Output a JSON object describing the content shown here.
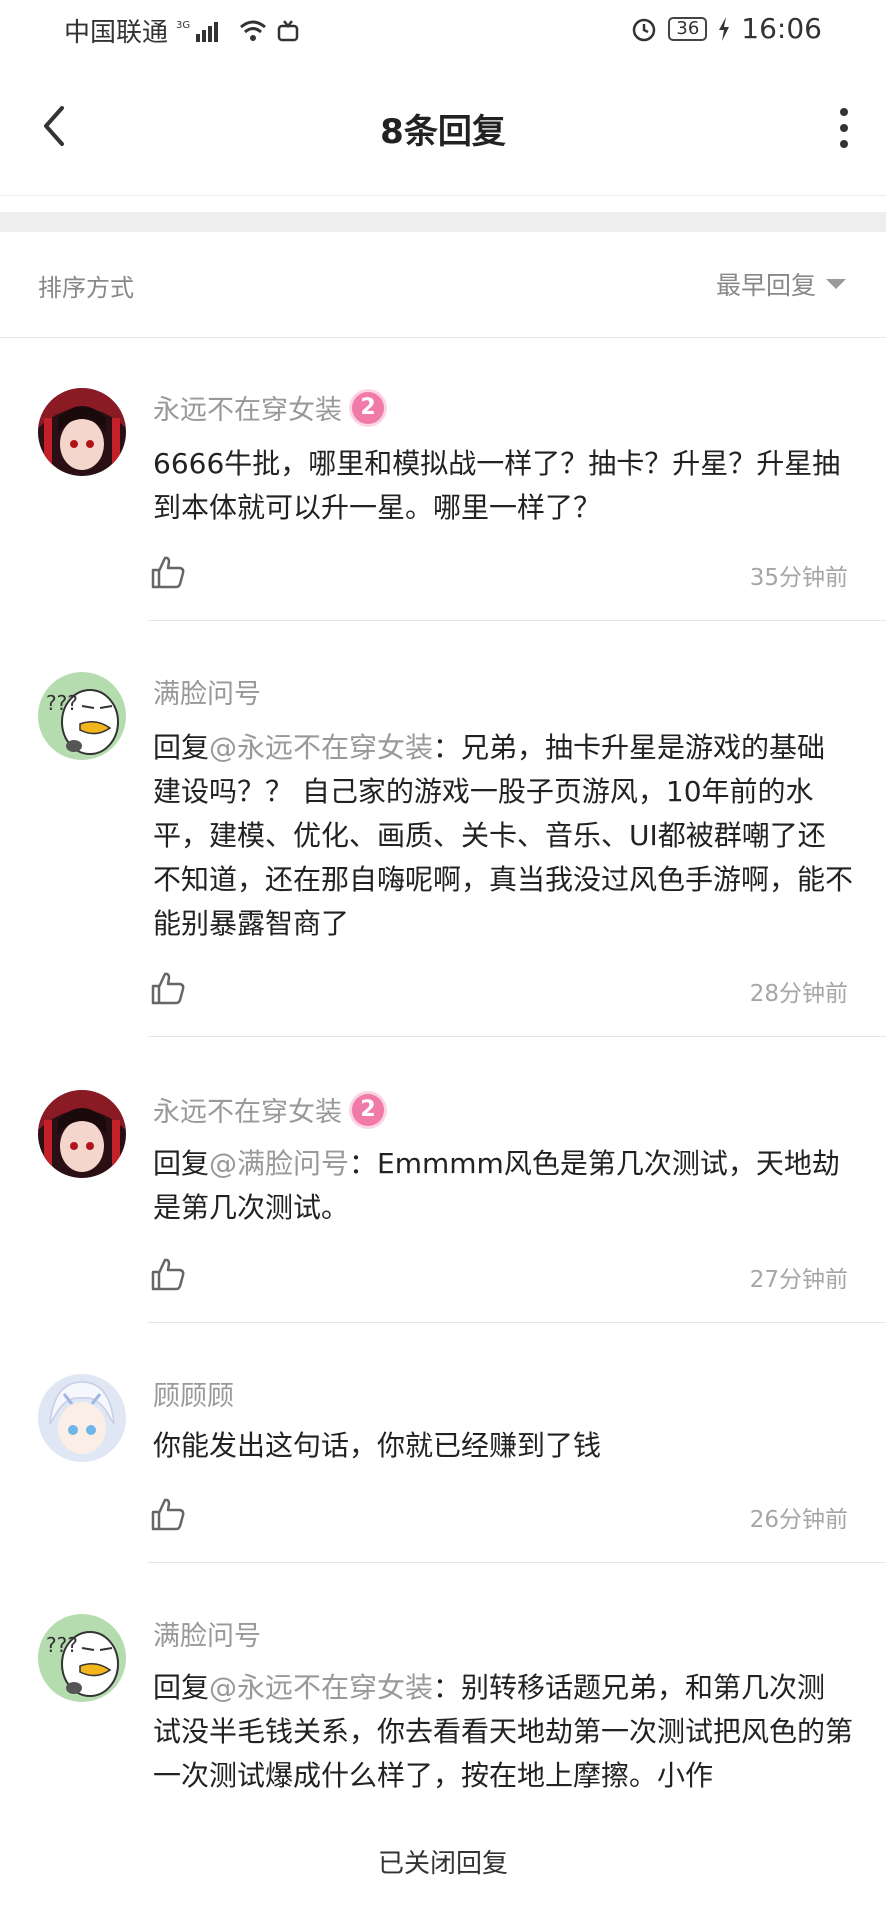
{
  "status_bar": {
    "carrier": "中国联通",
    "network": "3G",
    "battery": "36",
    "time": "16:06"
  },
  "nav": {
    "title": "8条回复",
    "back_icon": "chevron-left-icon",
    "more_icon": "more-vertical-icon"
  },
  "sort": {
    "label": "排序方式",
    "selected": "最早回复"
  },
  "comments": [
    {
      "user": "永远不在穿女装",
      "level": "2",
      "reply_prefix": "",
      "mention": "",
      "text": "6666牛批，哪里和模拟战一样了？抽卡？升星？升星抽到本体就可以升一星。哪里一样了？",
      "time": "35分钟前"
    },
    {
      "user": "满脸问号",
      "level": "",
      "reply_prefix": "回复",
      "mention": "@永远不在穿女装",
      "text": "：兄弟，抽卡升星是游戏的基础建设吗？？ 自己家的游戏一股子页游风，10年前的水平，建模、优化、画质、关卡、音乐、UI都被群嘲了还不知道，还在那自嗨呢啊，真当我没过风色手游啊，能不能别暴露智商了",
      "time": "28分钟前"
    },
    {
      "user": "永远不在穿女装",
      "level": "2",
      "reply_prefix": "回复",
      "mention": "@满脸问号",
      "text": "：Emmmm风色是第几次测试，天地劫是第几次测试。",
      "time": "27分钟前"
    },
    {
      "user": "顾顾顾",
      "level": "",
      "reply_prefix": "",
      "mention": "",
      "text": "你能发出这句话，你就已经赚到了钱",
      "time": "26分钟前"
    },
    {
      "user": "满脸问号",
      "level": "",
      "reply_prefix": "回复",
      "mention": "@永远不在穿女装",
      "text": "：别转移话题兄弟，和第几次测试没半毛钱关系，你去看看天地劫第一次测试把风色的第一次测试爆成什么样了，按在地上摩擦。小作",
      "time": ""
    }
  ],
  "footer": {
    "closed_text": "已关闭回复"
  },
  "colors": {
    "muted": "#999999",
    "badge": "#f07aa8",
    "divider": "#e6e6e6"
  }
}
